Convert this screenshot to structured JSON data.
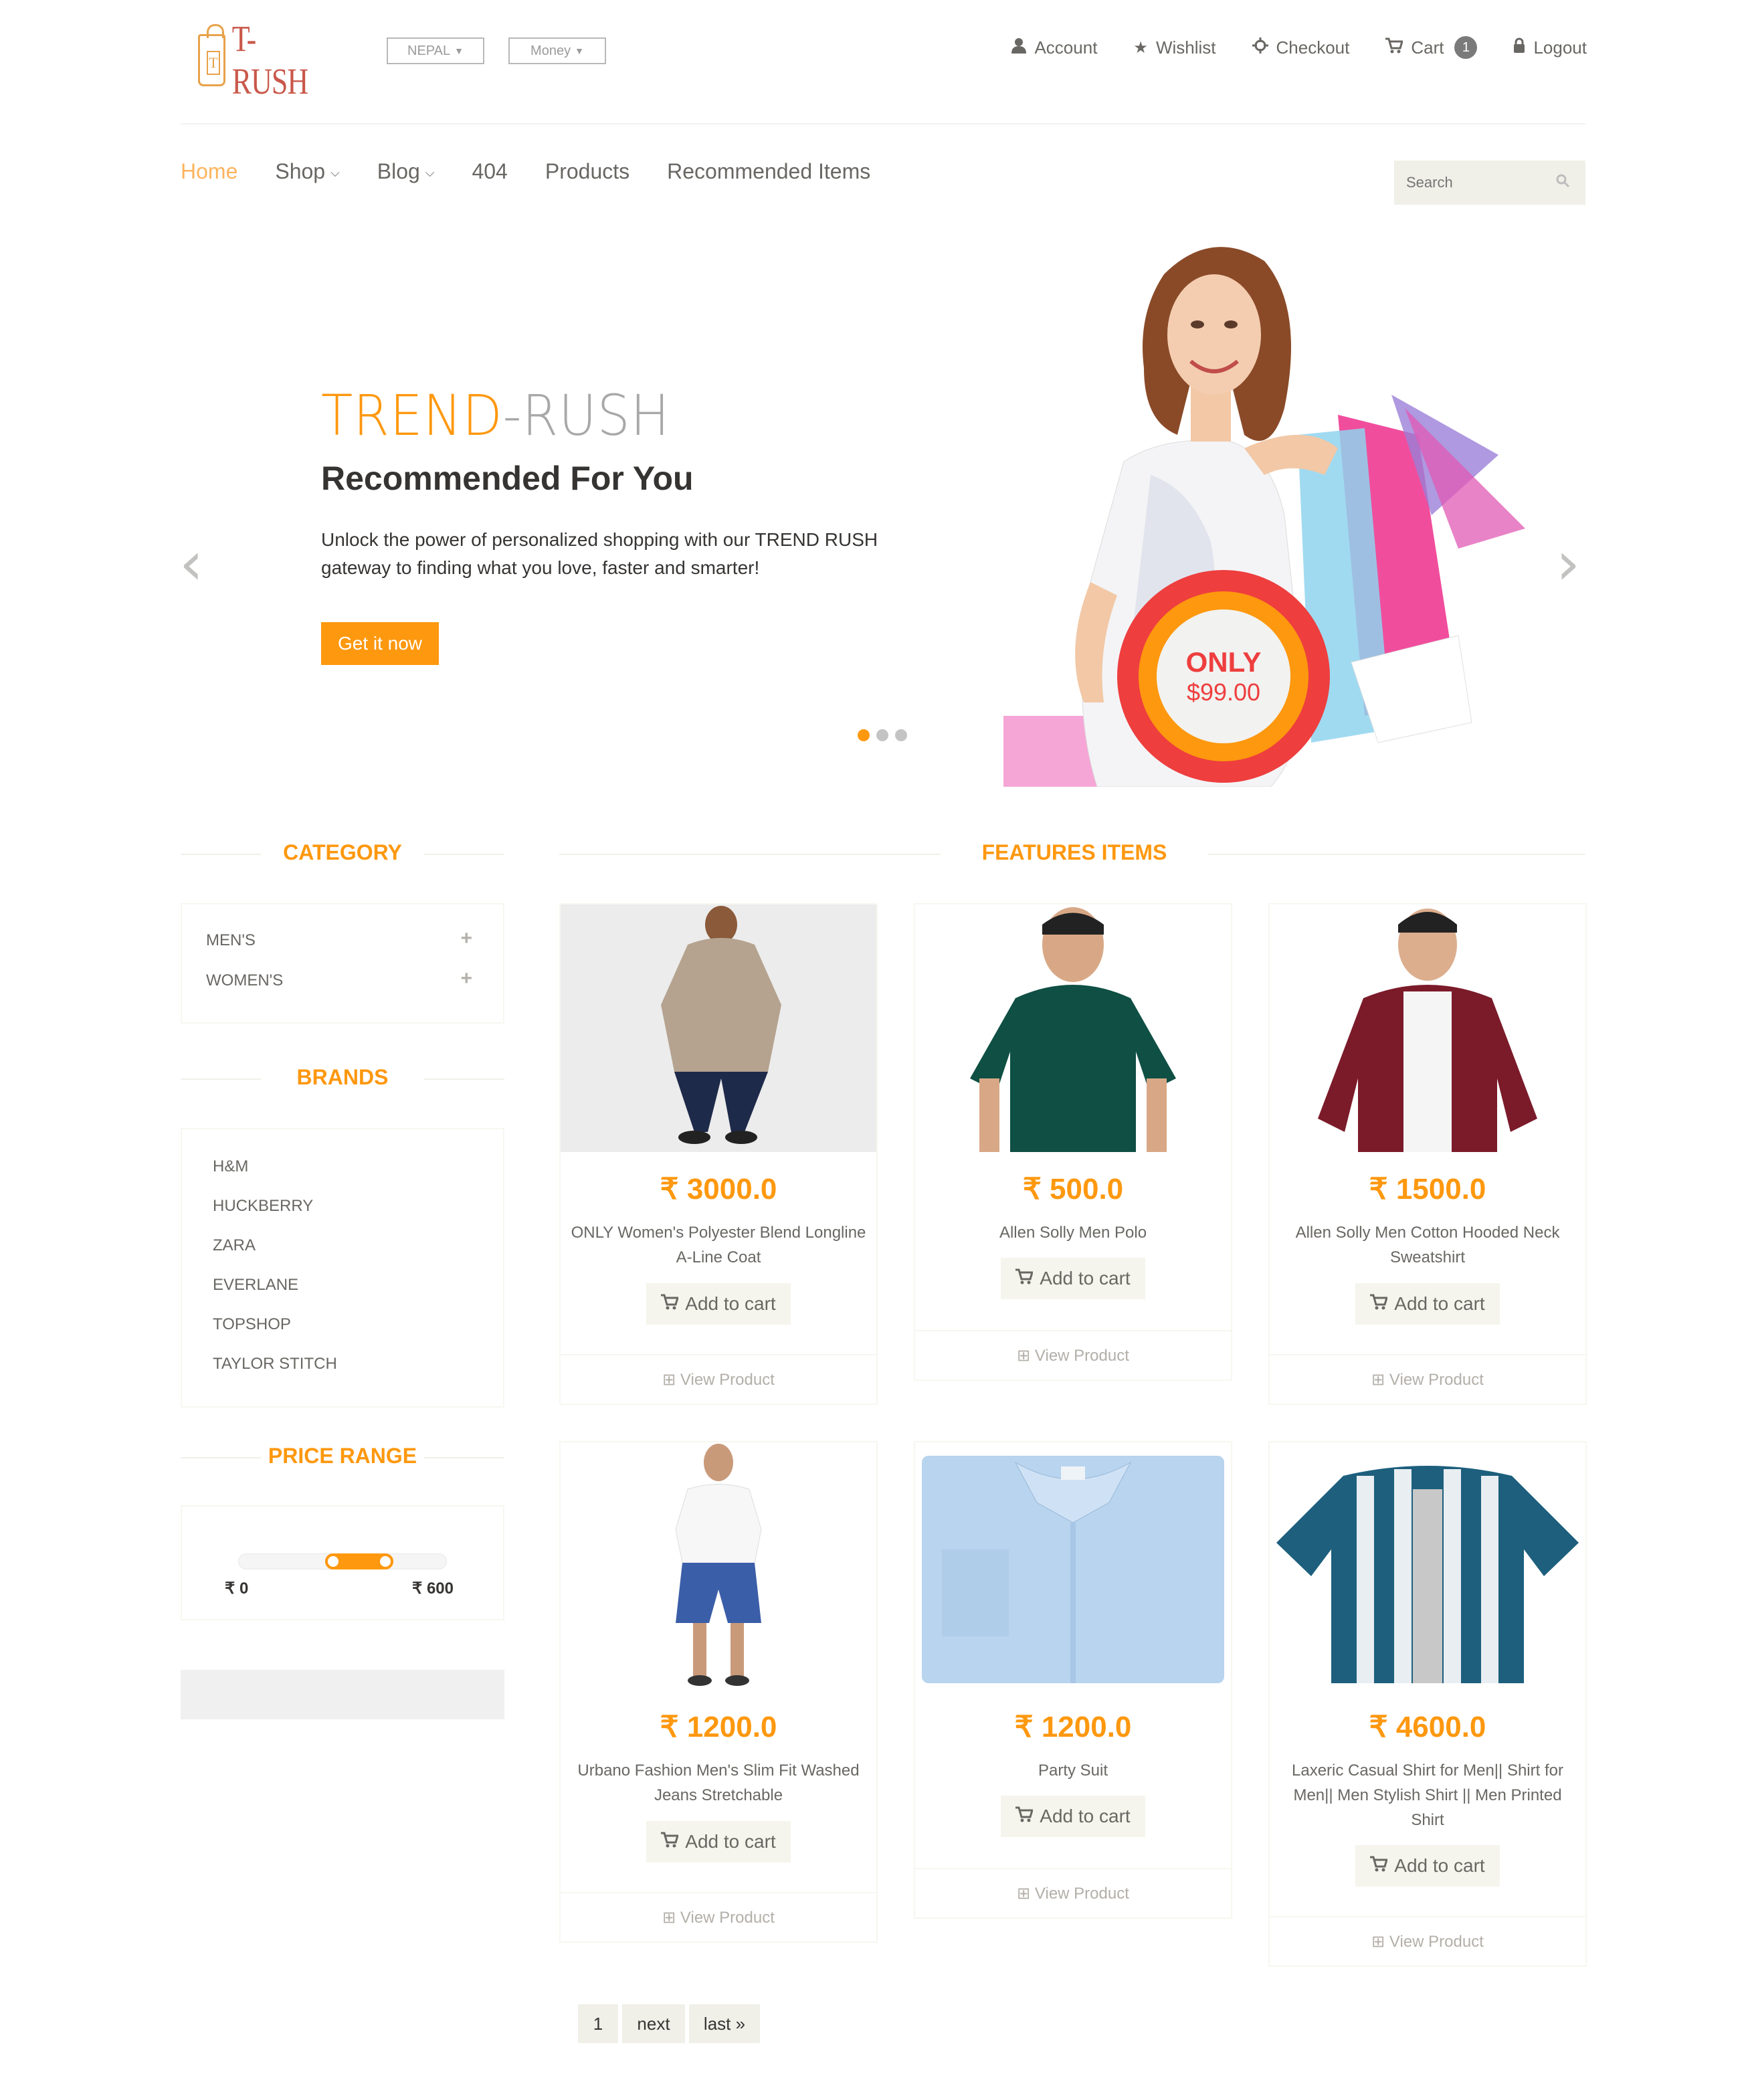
{
  "brand": {
    "logo_text": "T-RUSH",
    "logo_letter": "T"
  },
  "header": {
    "country_select": "NEPAL",
    "currency_select": "Money",
    "links": [
      {
        "icon": "user-icon",
        "label": "Account"
      },
      {
        "icon": "star-icon",
        "label": "Wishlist"
      },
      {
        "icon": "crosshairs-icon",
        "label": "Checkout"
      },
      {
        "icon": "shopping-cart-icon",
        "label": "Cart",
        "badge": "1"
      },
      {
        "icon": "lock-icon",
        "label": "Logout"
      }
    ]
  },
  "nav": {
    "items": [
      {
        "label": "Home",
        "active": true
      },
      {
        "label": "Shop",
        "dropdown": true
      },
      {
        "label": "Blog",
        "dropdown": true
      },
      {
        "label": "404"
      },
      {
        "label": "Products"
      },
      {
        "label": "Recommended Items"
      }
    ],
    "search_placeholder": "Search"
  },
  "slider": {
    "title_part1": "TREND",
    "title_part2": "-RUSH",
    "heading": "Recommended For You",
    "description": "Unlock the power of personalized shopping with our TREND RUSH gateway to finding what you love, faster and smarter!",
    "button": "Get it now",
    "badge_top": "ONLY",
    "badge_price": "$99.00",
    "active_dot": 0,
    "dot_count": 3
  },
  "sidebar": {
    "category_title": "CATEGORY",
    "categories": [
      "MEN'S",
      "WOMEN'S"
    ],
    "brands_title": "BRANDS",
    "brands": [
      "H&M",
      "HUCKBERRY",
      "ZARA",
      "EVERLANE",
      "TOPSHOP",
      "TAYLOR STITCH"
    ],
    "price_title": "PRICE RANGE",
    "price_min": "₹ 0",
    "price_max": "₹ 600"
  },
  "features": {
    "title": "FEATURES ITEMS",
    "add_to_cart": "Add to cart",
    "view_product": "View Product",
    "products": [
      {
        "price": "₹ 3000.0",
        "name": "ONLY Women's Polyester Blend Longline A-Line Coat"
      },
      {
        "price": "₹ 500.0",
        "name": "Allen Solly Men Polo"
      },
      {
        "price": "₹ 1500.0",
        "name": "Allen Solly Men Cotton Hooded Neck Sweatshirt"
      },
      {
        "price": "₹ 1200.0",
        "name": "Urbano Fashion Men's Slim Fit Washed Jeans Stretchable"
      },
      {
        "price": "₹ 1200.0",
        "name": "Party Suit"
      },
      {
        "price": "₹ 4600.0",
        "name": "Laxeric Casual Shirt for Men|| Shirt for Men|| Men Stylish Shirt || Men Printed Shirt"
      }
    ]
  },
  "pagination": {
    "page": "1",
    "next": "next",
    "last": "last »"
  },
  "colors": {
    "accent": "#fe980f",
    "text": "#696763",
    "dark": "#363432",
    "badge_red": "#ee3e3e"
  }
}
